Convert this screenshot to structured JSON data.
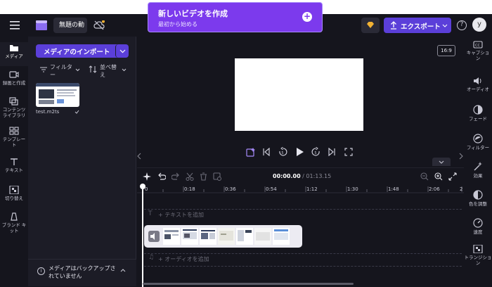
{
  "app": {
    "project_title": "無題の動",
    "accent": "#5b3fd9"
  },
  "promo": {
    "title": "新しいビデオを作成",
    "subtitle": "最初から始める"
  },
  "header": {
    "export_label": "エクスポート",
    "avatar_letter": "y"
  },
  "left_rail": {
    "items": [
      {
        "icon": "folder-icon",
        "label": "メディア"
      },
      {
        "icon": "record-icon",
        "label": "録画と作成"
      },
      {
        "icon": "content-library-icon",
        "label": "コンテンツ ライブラリ"
      },
      {
        "icon": "template-icon",
        "label": "テンプレー ト"
      },
      {
        "icon": "text-icon",
        "label": "テキスト"
      },
      {
        "icon": "transition-icon",
        "label": "切り替え"
      },
      {
        "icon": "brand-kit-icon",
        "label": "ブランド キット"
      }
    ]
  },
  "media_panel": {
    "import_label": "メディアのインポート",
    "filter_label": "フィルター",
    "sort_label": "並べ替え",
    "file_name": "test.m2ts",
    "backup_notice": "メディアはバックアップされていません"
  },
  "preview": {
    "aspect_ratio": "16:9"
  },
  "timeline": {
    "current_time": "00:00.00",
    "total_time": "01:13.15",
    "ticks": [
      "0",
      "0:18",
      "0:36",
      "0:54",
      "1:12",
      "1:30",
      "1:48",
      "2:06",
      "2"
    ],
    "add_text_label": "+ テキストを追加",
    "add_audio_label": "+ オーディオを追加"
  },
  "right_rail": {
    "items": [
      {
        "icon": "captions-icon",
        "label": "キャプショ ン"
      },
      {
        "icon": "audio-icon",
        "label": "オーディオ"
      },
      {
        "icon": "fade-icon",
        "label": "フェード"
      },
      {
        "icon": "filter-icon",
        "label": "フィルター"
      },
      {
        "icon": "effects-icon",
        "label": "効果"
      },
      {
        "icon": "color-adjust-icon",
        "label": "色を調整"
      },
      {
        "icon": "speed-icon",
        "label": "速度"
      },
      {
        "icon": "transition-icon",
        "label": "トランジショ ン"
      }
    ]
  }
}
